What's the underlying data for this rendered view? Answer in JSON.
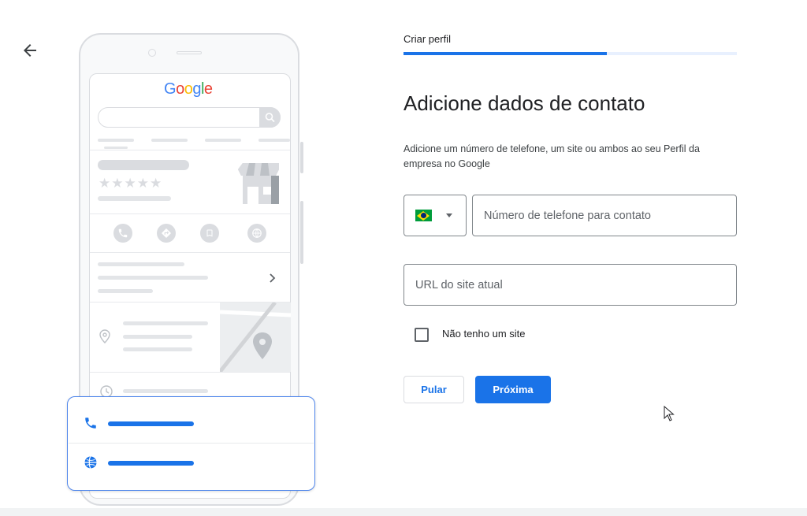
{
  "icons": {
    "back": "arrow-left-icon",
    "search": "search-icon",
    "phone": "phone-icon",
    "directions": "directions-icon",
    "bookmark": "bookmark-icon",
    "website": "globe-icon",
    "location": "location-pin-icon",
    "clock": "clock-icon",
    "chevron": "chevron-right-icon",
    "store": "storefront-icon",
    "map_pin": "map-pin-icon",
    "cursor": "mouse-pointer-icon"
  },
  "illustration": {
    "logo_letters": [
      "G",
      "o",
      "o",
      "g",
      "l",
      "e"
    ],
    "stars": "★★★★★"
  },
  "header": {
    "step_title": "Criar perfil",
    "progress": 0.61
  },
  "form": {
    "title": "Adicione dados de contato",
    "description": "Adicione um número de telefone, um site ou ambos ao seu Perfil da empresa no Google",
    "country_code": "BR",
    "phone_placeholder": "Número de telefone para contato",
    "url_placeholder": "URL do site atual",
    "no_site_label": "Não tenho um site",
    "no_site_checked": false
  },
  "buttons": {
    "skip": "Pular",
    "next": "Próxima"
  },
  "colors": {
    "accent": "#1a73e8",
    "progress_track": "#e8f0fe",
    "border": "#80868b"
  }
}
